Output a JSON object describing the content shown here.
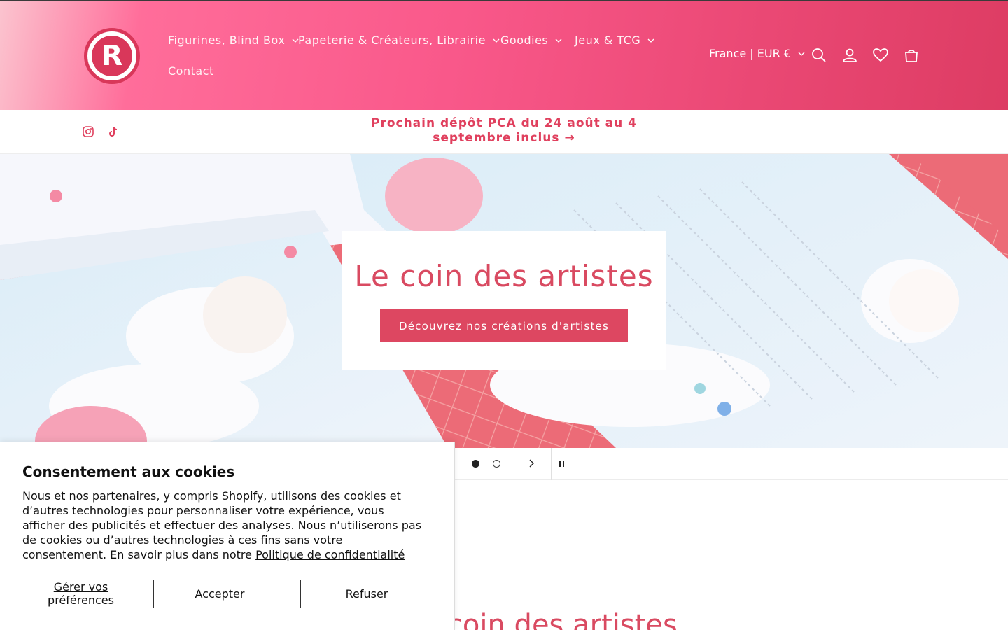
{
  "header": {
    "logo_letter": "R",
    "nav": [
      {
        "label": "Figurines, Blind Box",
        "has_dropdown": true
      },
      {
        "label": "Papeterie & Créateurs, Librairie",
        "has_dropdown": true
      },
      {
        "label": "Goodies",
        "has_dropdown": true
      },
      {
        "label": "Jeux & TCG",
        "has_dropdown": true
      },
      {
        "label": "Contact",
        "has_dropdown": false
      }
    ],
    "country_selector": "France | EUR €",
    "icons": [
      "search-icon",
      "account-icon",
      "wishlist-heart-icon",
      "cart-icon"
    ]
  },
  "announcement": {
    "social_icons": [
      "instagram-icon",
      "tiktok-icon"
    ],
    "text": "Prochain dépôt PCA du 24 août au 4 septembre inclus",
    "arrow": "→"
  },
  "hero": {
    "title": "Le coin des artistes",
    "button_label": "Découvrez nos créations d'artistes"
  },
  "slider": {
    "slide_count": 2,
    "active_slide": 1
  },
  "section": {
    "title": "Le coin des artistes"
  },
  "cookie_banner": {
    "title": "Consentement aux cookies",
    "text": "Nous et nos partenaires, y compris Shopify, utilisons des cookies et d’autres technologies pour personnaliser votre expérience, vous afficher des publicités et effectuer des analyses. Nous n’utiliserons pas de cookies ou d’autres technologies à ces fins sans votre consentement. En savoir plus dans notre",
    "link_label": "Politique de confidentialité",
    "manage_label": "Gérer vos préférences",
    "accept_label": "Accepter",
    "refuse_label": "Refuser"
  },
  "colors": {
    "brand_pink": "#f9588a",
    "brand_red": "#dd4761",
    "announcement_text": "#e0405e"
  }
}
